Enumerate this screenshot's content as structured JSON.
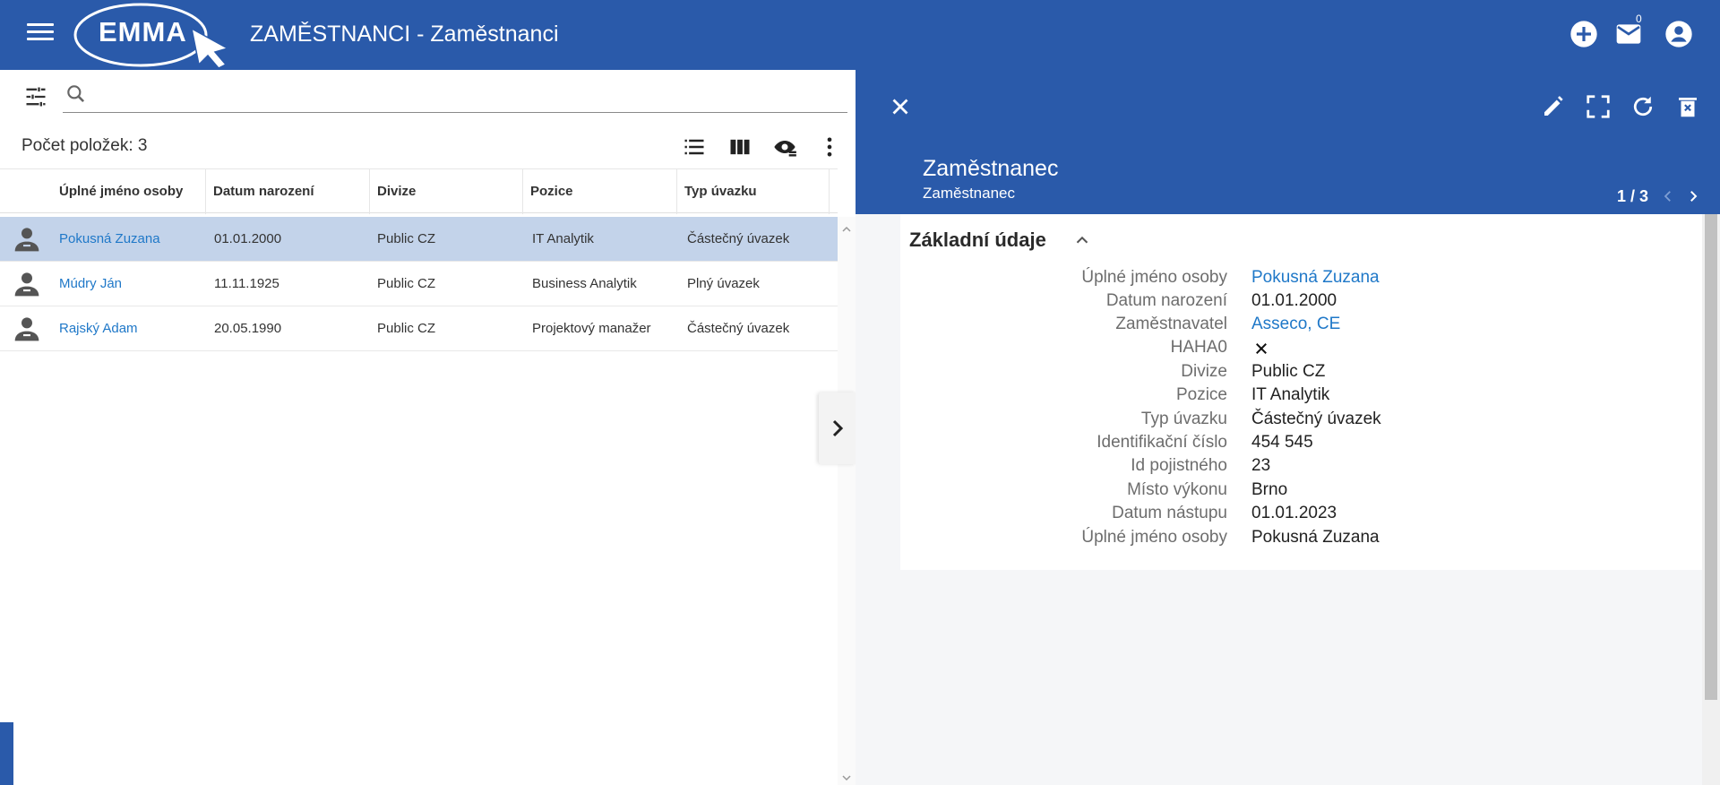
{
  "header": {
    "logo_text": "EMMA",
    "title": "ZAMĚSTNANCI - Zaměstnanci",
    "mail_count": "0",
    "icons": [
      "menu-icon",
      "add-circle-icon",
      "mail-icon",
      "account-circle-icon"
    ],
    "background": "#2a5aaa"
  },
  "list": {
    "search_placeholder": "",
    "count_label": "Počet položek: 3",
    "tool_icons": [
      "list-view-icon",
      "columns-icon",
      "visibility-settings-icon",
      "more-vertical-icon"
    ],
    "columns": [
      "Úplné jméno osoby",
      "Datum narození",
      "Divize",
      "Pozice",
      "Typ úvazku"
    ],
    "rows": [
      {
        "name": "Pokusná Zuzana",
        "birth": "01.01.2000",
        "division": "Public CZ",
        "position": "IT Analytik",
        "contract": "Částečný úvazek",
        "selected": true
      },
      {
        "name": "Múdry Ján",
        "birth": "11.11.1925",
        "division": "Public CZ",
        "position": "Business Analytik",
        "contract": "Plný úvazek",
        "selected": false
      },
      {
        "name": "Rajský Adam",
        "birth": "20.05.1990",
        "division": "Public CZ",
        "position": "Projektový manažer",
        "contract": "Částečný úvazek",
        "selected": false
      }
    ]
  },
  "detail": {
    "title": "Zaměstnanec",
    "subtitle": "Zaměstnanec",
    "pager": "1 / 3",
    "icons": [
      "close-icon",
      "edit-icon",
      "fullscreen-icon",
      "refresh-icon",
      "delete-icon"
    ],
    "section_title": "Základní údaje",
    "fields": [
      {
        "label": "Úplné jméno osoby",
        "value": "Pokusná Zuzana",
        "link": true
      },
      {
        "label": "Datum narození",
        "value": "01.01.2000",
        "link": false
      },
      {
        "label": "Zaměstnavatel",
        "value": "Asseco, CE",
        "link": true
      },
      {
        "label": "HAHA0",
        "value": "",
        "icon": "x-icon"
      },
      {
        "label": "Divize",
        "value": "Public CZ",
        "link": false
      },
      {
        "label": "Pozice",
        "value": "IT Analytik",
        "link": false
      },
      {
        "label": "Typ úvazku",
        "value": "Částečný úvazek",
        "link": false
      },
      {
        "label": "Identifikační číslo",
        "value": "454 545",
        "link": false
      },
      {
        "label": "Id pojistného",
        "value": "23",
        "link": false
      },
      {
        "label": "Místo výkonu",
        "value": "Brno",
        "link": false
      },
      {
        "label": "Datum nástupu",
        "value": "01.01.2023",
        "link": false
      },
      {
        "label": "Úplné jméno osoby",
        "value": "Pokusná Zuzana",
        "link": false
      }
    ]
  }
}
